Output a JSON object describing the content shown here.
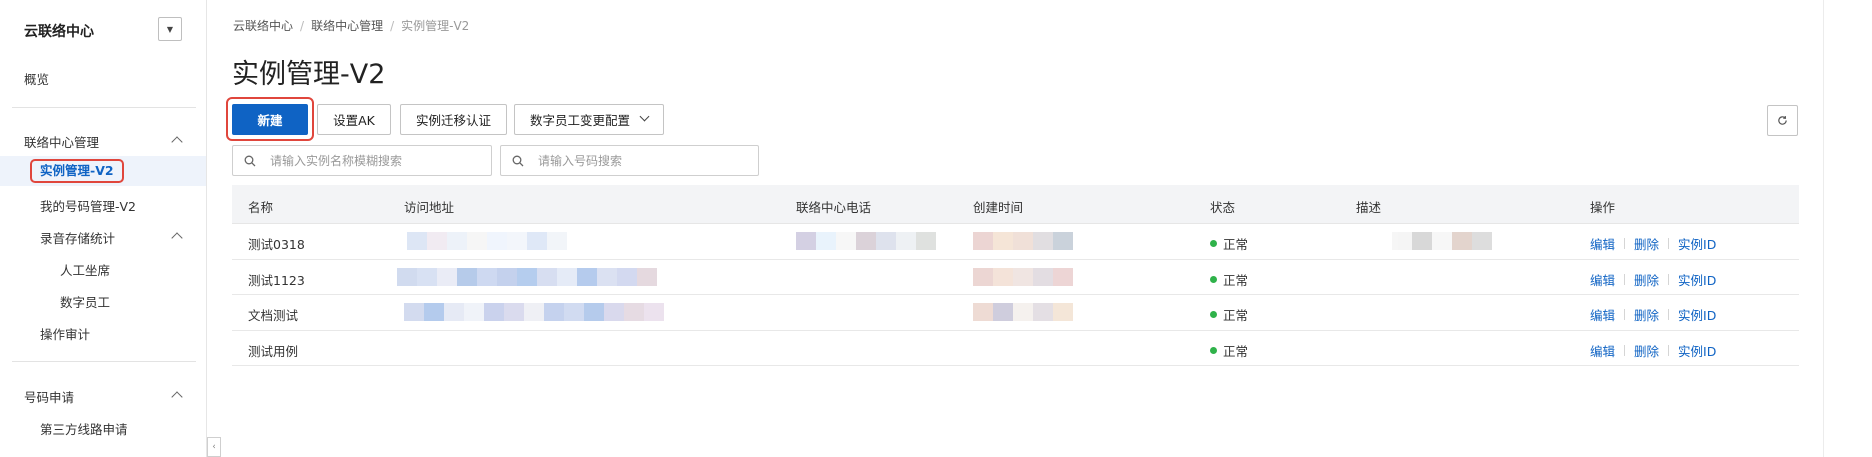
{
  "sidebar": {
    "title": "云联络中心",
    "overview": "概览",
    "groups": [
      {
        "label": "联络中心管理"
      },
      {
        "label": "录音存储统计"
      },
      {
        "label": "号码申请"
      }
    ],
    "items": {
      "instance_v2": "实例管理-V2",
      "my_numbers": "我的号码管理-V2",
      "agent": "人工坐席",
      "digital": "数字员工",
      "audit": "操作审计",
      "third_party": "第三方线路申请"
    }
  },
  "breadcrumb": [
    "云联络中心",
    "联络中心管理",
    "实例管理-V2"
  ],
  "page_title": "实例管理-V2",
  "toolbar": {
    "new": "新建",
    "set_ak": "设置AK",
    "migrate": "实例迁移认证",
    "digital_cfg": "数字员工变更配置"
  },
  "search": {
    "instance_placeholder": "请输入实例名称模糊搜索",
    "number_placeholder": "请输入号码搜索"
  },
  "table": {
    "columns": [
      "名称",
      "访问地址",
      "联络中心电话",
      "创建时间",
      "状态",
      "描述",
      "操作"
    ],
    "rows": [
      {
        "name": "测试0318",
        "status": "正常"
      },
      {
        "name": "测试1123",
        "status": "正常"
      },
      {
        "name": "文档测试",
        "status": "正常"
      },
      {
        "name": "测试用例",
        "status": "正常"
      }
    ],
    "actions": [
      "编辑",
      "删除",
      "实例ID"
    ]
  },
  "colors": {
    "primary": "#0f63c4",
    "highlight": "#e0463c",
    "status_ok": "#2fb24a"
  }
}
